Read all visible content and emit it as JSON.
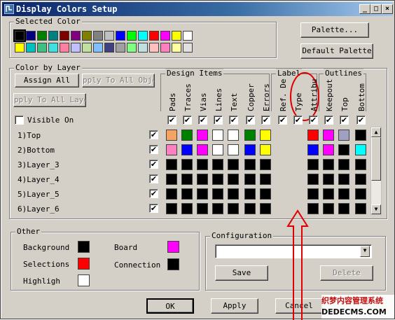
{
  "window": {
    "title": "Display Colors Setup",
    "min": "_",
    "max": "□",
    "close": "×"
  },
  "selected_color": {
    "label": "Selected Color",
    "row1": [
      "#000000",
      "#000080",
      "#008000",
      "#008080",
      "#800000",
      "#800080",
      "#808000",
      "#808080",
      "#c0c0c0",
      "#0000ff",
      "#00ff00",
      "#00ffff",
      "#ff0000",
      "#ff00ff",
      "#ffff00",
      "#ffffff"
    ],
    "row2": [
      "#ffff00",
      "#00c0c0",
      "#40c080",
      "#40e0e0",
      "#ff80a0",
      "#c0c0ff",
      "#c0e0a0",
      "#80c0ff",
      "#404080",
      "#a0a0a0",
      "#80ff80",
      "#c0e0e0",
      "#ffc0c0",
      "#ff80c0",
      "#ffffa0",
      "#e0e0e0"
    ]
  },
  "palette_button": "Palette...",
  "default_palette_button": "Default Palette",
  "color_by_layer": {
    "label": "Color by Layer",
    "assign_all": "Assign All",
    "apply_to_all_objects": "pply To All Object",
    "apply_to_all_layers": "pply To All Layer",
    "visible_on": "Visible On",
    "groups": {
      "design_items": "Design Items",
      "labels": "Label",
      "outlines": "Outlines"
    },
    "columns": [
      "Pads",
      "Traces",
      "Vias",
      "Lines",
      "Text",
      "Copper",
      "Errors",
      "Ref. De",
      "Type",
      "Attribu",
      "Keepout",
      "Top",
      "Bottom"
    ],
    "layers": [
      {
        "name": "1)Top",
        "colors": [
          "#f4a460",
          "#008000",
          "#ff00ff",
          "#ffffff",
          "#ffffff",
          "#008000",
          "#ffff00",
          "",
          "",
          "#ff0000",
          "#ff00ff",
          "#a0a0c0",
          "#000000"
        ]
      },
      {
        "name": "2)Bottom",
        "colors": [
          "#ff80c0",
          "#0000ff",
          "#ff00ff",
          "#ffffff",
          "#ffffff",
          "#0000ff",
          "#ffff00",
          "",
          "",
          "#0000ff",
          "#ff00ff",
          "#000000",
          "#00ffff"
        ]
      },
      {
        "name": "3)Layer_3",
        "colors": [
          "#000000",
          "#000000",
          "#000000",
          "#000000",
          "#000000",
          "#000000",
          "#000000",
          "",
          "",
          "#000000",
          "#000000",
          "#000000",
          "#000000"
        ]
      },
      {
        "name": "4)Layer_4",
        "colors": [
          "#000000",
          "#000000",
          "#000000",
          "#000000",
          "#000000",
          "#000000",
          "#000000",
          "",
          "",
          "#000000",
          "#000000",
          "#000000",
          "#000000"
        ]
      },
      {
        "name": "5)Layer_5",
        "colors": [
          "#000000",
          "#000000",
          "#000000",
          "#000000",
          "#000000",
          "#000000",
          "#000000",
          "",
          "",
          "#000000",
          "#000000",
          "#000000",
          "#000000"
        ]
      },
      {
        "name": "6)Layer_6",
        "colors": [
          "#000000",
          "#000000",
          "#000000",
          "#000000",
          "#000000",
          "#000000",
          "#000000",
          "",
          "",
          "#000000",
          "#000000",
          "#000000",
          "#000000"
        ]
      }
    ]
  },
  "other": {
    "label": "Other",
    "items": [
      {
        "name": "Background",
        "color": "#000000"
      },
      {
        "name": "Board",
        "color": "#ff00ff"
      },
      {
        "name": "Selections",
        "color": "#ff0000"
      },
      {
        "name": "Connection",
        "color": "#000000"
      },
      {
        "name": "Highligh",
        "color": "#ffffff"
      }
    ]
  },
  "configuration": {
    "label": "Configuration",
    "value": "",
    "save": "Save",
    "delete": "Delete"
  },
  "footer": {
    "ok": "OK",
    "apply": "Apply",
    "cancel": "Cancel"
  },
  "watermark": {
    "line1": "织梦内容管理系统",
    "line2": "DEDECMS.COM"
  },
  "colors": {
    "annotation": "#ff0000",
    "title_bar": "#0a246a"
  }
}
